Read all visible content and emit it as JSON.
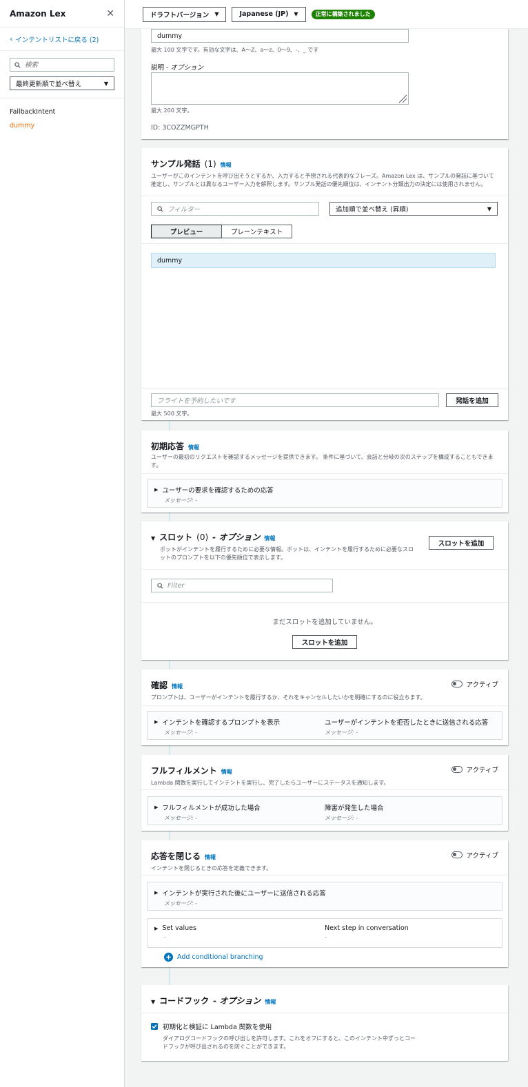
{
  "sidebar": {
    "title": "Amazon Lex",
    "back_link": "インテントリストに戻る (2)",
    "search_placeholder": "検索",
    "sort_label": "最終更新順で並べ替え",
    "intents": [
      "FallbackIntent",
      "dummy"
    ]
  },
  "topbar": {
    "version_label": "ドラフトバージョン",
    "language_label": "Japanese (JP)",
    "status_badge": "正常に構築されました"
  },
  "details": {
    "name_value": "dummy",
    "name_hint": "最大 100 文字です。有効な文字は、A〜Z、a〜z、0〜9、-、_ です",
    "desc_label": "説明 - ",
    "desc_optional": "オプション",
    "desc_hint": "最大 200 文字。",
    "id_text": "ID: 3COZZMGPTH"
  },
  "utterances": {
    "title": "サンプル発話",
    "count": "(1)",
    "info": "情報",
    "description": "ユーザーがこのインテントを呼び出そうとするか、入力すると予想される代表的なフレーズ。Amazon Lex は、サンプルの発話に基づいて推定し、サンプルとは異なるユーザー入力を解釈します。サンプル発話の優先順位は、インテント分類出力の決定には使用されません。",
    "filter_placeholder": "フィルター",
    "sort_label": "追加順で並べ替え (昇順)",
    "tab_preview": "プレビュー",
    "tab_plain": "プレーンテキスト",
    "items": [
      "dummy"
    ],
    "add_placeholder": "フライトを予約したいです",
    "add_button": "発話を追加",
    "add_hint": "最大 500 文字。"
  },
  "initial_response": {
    "title": "初期応答",
    "info": "情報",
    "description": "ユーザーの最初のリクエストを確認するメッセージを提供できます。 条件に基づいて、会話と分岐の次のステップを構成することもできます。",
    "card_title": "ユーザーの要求を確認するための応答",
    "card_sub": "メッセージ: -"
  },
  "slots": {
    "title": "スロット",
    "count": "(0)",
    "optional": "- オプション",
    "info": "情報",
    "description": "ボットがインテントを履行するために必要な情報。ボットは、インテントを履行するために必要なスロットのプロンプトを以下の優先順位で表示します。",
    "add_button": "スロットを追加",
    "filter_placeholder": "Filter",
    "empty_text": "まだスロットを追加していません。",
    "add_button_center": "スロットを追加"
  },
  "confirmation": {
    "title": "確認",
    "info": "情報",
    "description": "プロンプトは、ユーザーがインテントを履行するか、それをキャンセルしたいかを明確にするのに役立ちます。",
    "toggle_label": "アクティブ",
    "col1_title": "インテントを確認するプロンプトを表示",
    "col1_sub": "メッセージ: -",
    "col2_title": "ユーザーがインテントを拒否したときに送信される応答",
    "col2_sub": "メッセージ: -"
  },
  "fulfillment": {
    "title": "フルフィルメント",
    "info": "情報",
    "description": "Lambda 関数を実行してインテントを実行し、完了したらユーザーにステータスを通知します。",
    "toggle_label": "アクティブ",
    "col1_title": "フルフィルメントが成功した場合",
    "col1_sub": "メッセージ: -",
    "col2_title": "障害が発生した場合",
    "col2_sub": "メッセージ: -"
  },
  "closing": {
    "title": "応答を閉じる",
    "info": "情報",
    "description": "インテントを閉じるときの応答を定義できます。",
    "toggle_label": "アクティブ",
    "card_title": "インテントが実行された後にユーザーに送信される応答",
    "card_sub": "メッセージ: -",
    "set_values": "Set values",
    "set_values_sub": "-",
    "next_step": "Next step in conversation",
    "next_step_sub": "-",
    "add_branch": "Add conditional branching"
  },
  "codehook": {
    "title": "コードフック",
    "optional": "- オプション",
    "info": "情報",
    "checkbox_label": "初期化と検証に Lambda 関数を使用",
    "checkbox_desc": "ダイアログコードフックの呼び出しを許可します。これをオフにすると、このインテント中ずっとコードフックが呼び出されるのを防ぐことができます。"
  }
}
